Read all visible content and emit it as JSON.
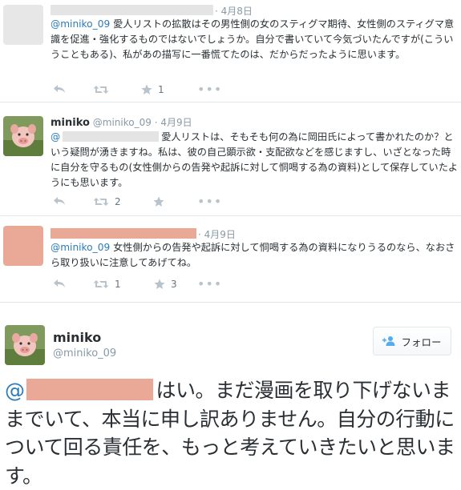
{
  "tweets": [
    {
      "date": "4月8日",
      "mention": "@miniko_09",
      "text": " 愛人リストの拡散はその男性側の女のスティグマ期待、女性側のスティグマ意識を促進・強化するものではないでしょうか。自分で書いていて今気づいたんですが(こういうこともある)、私があの描写に一番慌てたのは、だからだったように思います。",
      "reply_count": "",
      "retweet_count": "",
      "favorite_count": "1"
    },
    {
      "name": "miniko",
      "handle": "@miniko_09",
      "date": "4月9日",
      "mention": "@",
      "text_after_redact": "愛人リストは、そもそも何の為に岡田氏によって書かれたのか？という疑問が湧きますね。私は、彼の自己顕示欲・支配欲などを感じますし、いざとなった時に自分を守るもの(女性側からの告発や起訴に対して恫喝する為の資料)として保存していたようにも思います。",
      "reply_count": "",
      "retweet_count": "2",
      "favorite_count": ""
    },
    {
      "date": "4月9日",
      "mention": "@miniko_09",
      "text": " 女性側からの告発や起訴に対して恫喝する為の資料になりうるのなら、なおさら取り扱いに注意してあげてね。",
      "reply_count": "",
      "retweet_count": "1",
      "favorite_count": "3"
    }
  ],
  "main_tweet": {
    "name": "miniko",
    "handle": "@miniko_09",
    "follow_label": "フォロー",
    "at_sign": "@",
    "text": "はい。まだ漫画を取り下げないままでいて、本当に申し訳ありません。自分の行動について回る責任を、もっと考えていきたいと思います。"
  },
  "icons": [
    "reply-icon",
    "retweet-icon",
    "favorite-icon",
    "more-icon",
    "follow-person-icon"
  ],
  "colors": {
    "link": "#2b7bb9",
    "muted": "#8899a6",
    "redaction_gray": "#e4e4e4",
    "redaction_salmon": "#eaa897"
  }
}
